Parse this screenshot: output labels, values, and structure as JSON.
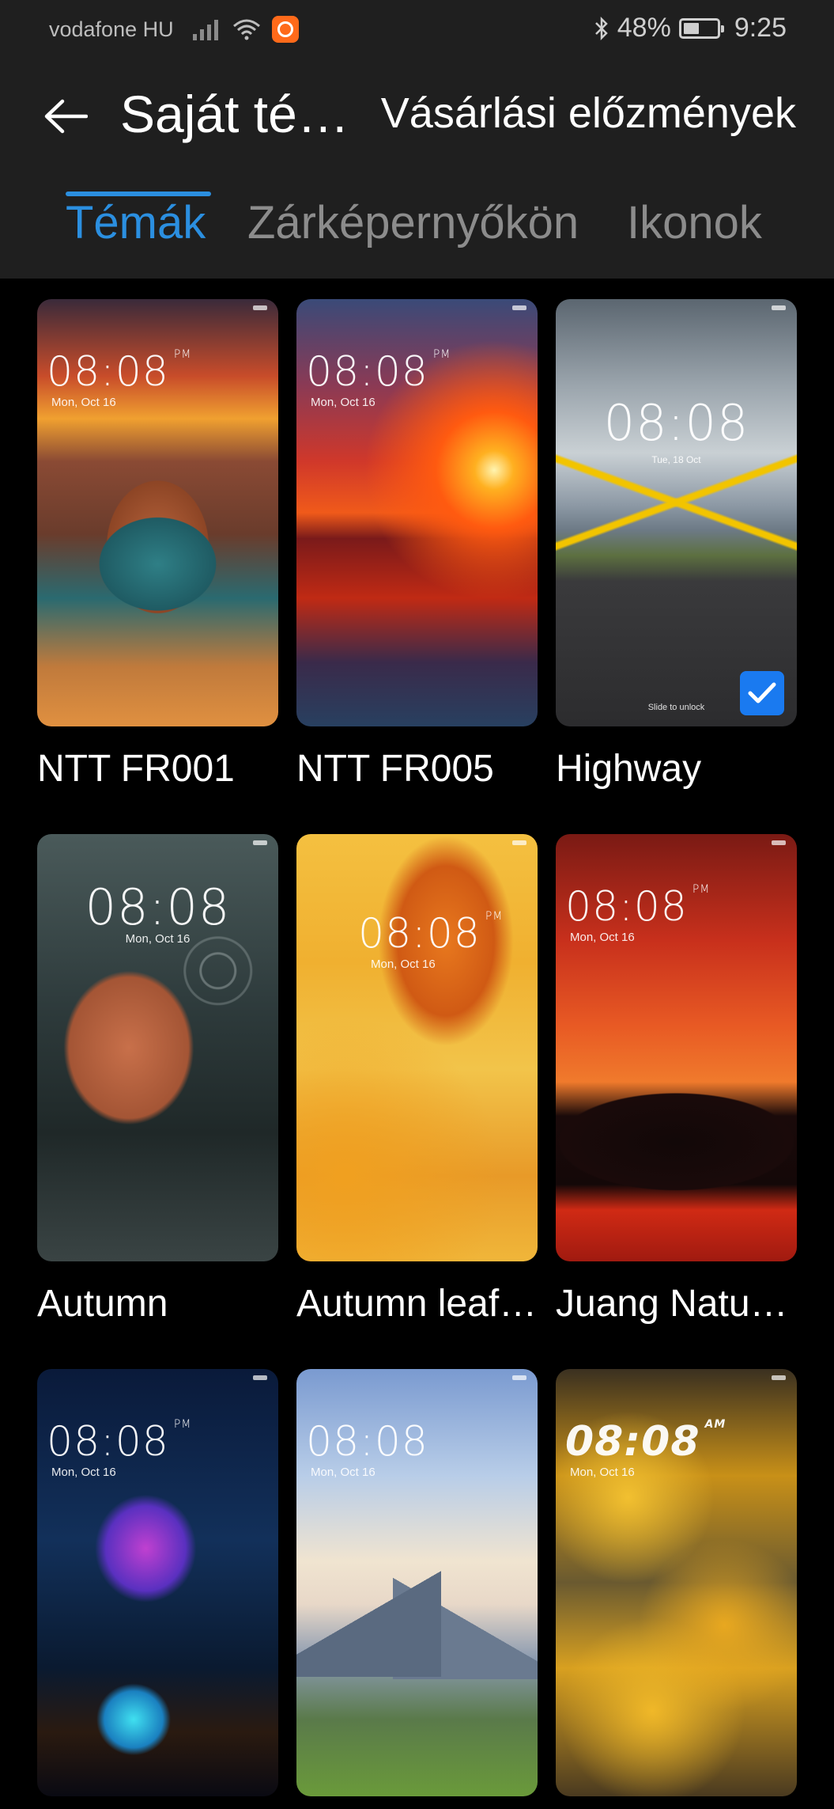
{
  "status_bar": {
    "carrier": "vodafone HU",
    "battery": "48%",
    "battery_level": 0.48,
    "time": "9:25",
    "icons": [
      "signal-icon",
      "wifi-icon",
      "npc-icon",
      "bluetooth-icon",
      "battery-icon"
    ]
  },
  "app_bar": {
    "back_icon": "back-arrow-icon",
    "title": "Saját té…",
    "action": "Vásárlási előzmények"
  },
  "tabs": [
    {
      "label": "Témák",
      "active": true
    },
    {
      "label": "Zárképernyőkön",
      "active": false
    },
    {
      "label": "Ikonok",
      "active": false
    }
  ],
  "themes": [
    {
      "name": "NTT FR001",
      "clock": "08:08",
      "ampm": "PM",
      "date": "Mon, Oct 16",
      "selected": false
    },
    {
      "name": "NTT FR005",
      "clock": "08:08",
      "ampm": "PM",
      "date": "Mon, Oct 16",
      "selected": false
    },
    {
      "name": "Highway",
      "clock": "08:08",
      "ampm": "",
      "date": "Tue, 18 Oct",
      "unlock": "Slide to unlock",
      "selected": true
    },
    {
      "name": "Autumn",
      "clock": "08:08",
      "ampm": "",
      "date": "Mon, Oct 16",
      "selected": false
    },
    {
      "name": "Autumn leaf…",
      "clock": "08:08",
      "ampm": "PM",
      "date": "Mon, Oct 16",
      "selected": false
    },
    {
      "name": "Juang Natu…",
      "clock": "08:08",
      "ampm": "PM",
      "date": "Mon, Oct 16",
      "selected": false
    },
    {
      "name": "",
      "clock": "08:08",
      "ampm": "PM",
      "date": "Mon, Oct 16",
      "selected": false
    },
    {
      "name": "",
      "clock": "08:08",
      "ampm": "",
      "date": "Mon, Oct 16",
      "selected": false
    },
    {
      "name": "",
      "clock": "08:08",
      "ampm": "AM",
      "date": "Mon, Oct 16",
      "selected": false
    }
  ],
  "colors": {
    "accent": "#2b8fe0",
    "check": "#1a7af0",
    "bar_background": "#1f1f1f",
    "page_background": "#000000"
  }
}
